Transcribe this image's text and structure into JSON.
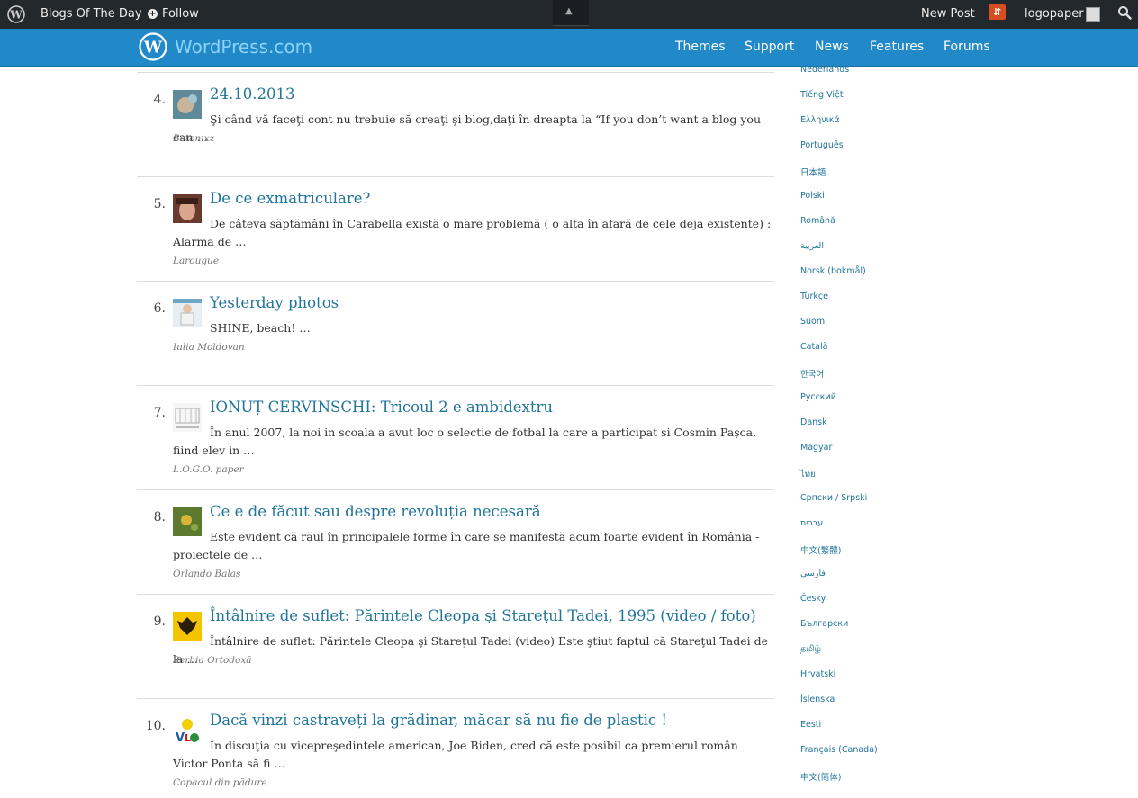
{
  "admin_bar": {
    "site_name": "Blogs Of The Day",
    "follow_label": "Follow",
    "new_post_label": "New Post",
    "notification_count": "⇵",
    "username": "logopaper"
  },
  "header": {
    "brand": "WordPress.com",
    "nav": [
      "Themes",
      "Support",
      "News",
      "Features",
      "Forums"
    ]
  },
  "posts": [
    {
      "rank": "4.",
      "title": "24.10.2013",
      "excerpt": "Şi când vă faceţi cont nu trebuie să creaţi şi blog,daţi în dreapta la “If you don’t want a blog you can …",
      "author": "Betonixz"
    },
    {
      "rank": "5.",
      "title": "De ce exmatriculare?",
      "excerpt": "De câteva săptămâni în Carabella există o mare problemă ( o alta în afară de cele deja existente) : Alarma de …",
      "author": "Larougue"
    },
    {
      "rank": "6.",
      "title": "Yesterday photos",
      "excerpt": "SHINE, beach! …",
      "author": "Iulia Moldovan"
    },
    {
      "rank": "7.",
      "title": "IONUȚ CERVINSCHI: Tricoul 2 e ambidextru",
      "excerpt": "În anul 2007, la noi in scoala a avut loc o selectie de fotbal la care a participat si Cosmin Pașca, fiind elev in …",
      "author": "L.O.G.O. paper"
    },
    {
      "rank": "8.",
      "title": "Ce e de făcut sau despre revoluția necesară",
      "excerpt": "Este evident că răul în principalele forme în care se manifestă acum foarte evident în România - proiectele de …",
      "author": "Orlando Balaș"
    },
    {
      "rank": "9.",
      "title": "Întâlnire de suflet: Părintele Cleopa şi Stareţul Tadei, 1995 (video / foto)",
      "excerpt": "Întâlnire de suflet: Părintele Cleopa şi Stareţul Tadei (video) Este ştiut faptul că Stareţul Tadei de la …",
      "author": "Serbia Ortodoxă"
    },
    {
      "rank": "10.",
      "title": "Dacă vinzi castraveți la grădinar, măcar să nu fie de plastic !",
      "excerpt": "În discuţia cu vicepreşedintele american, Joe Biden, cred că este posibil ca premierul român Victor Ponta să fi …",
      "author": "Copacul din pădure"
    }
  ],
  "languages": [
    "Nederlands",
    "Tiếng Việt",
    "Ελληνικά",
    "Português",
    "日本語",
    "Polski",
    "Română",
    "العربية",
    "Norsk (bokmål)",
    "Türkçe",
    "Suomi",
    "Català",
    "한국어",
    "Русский",
    "Dansk",
    "Magyar",
    "ไทย",
    "Српски / Srpski",
    "עברית",
    "中文(繁體)",
    "فارسی",
    "Česky",
    "Български",
    "தமிழ்",
    "Hrvatski",
    "Íslenska",
    "Eesti",
    "Français (Canada)",
    "中文(简体)"
  ]
}
